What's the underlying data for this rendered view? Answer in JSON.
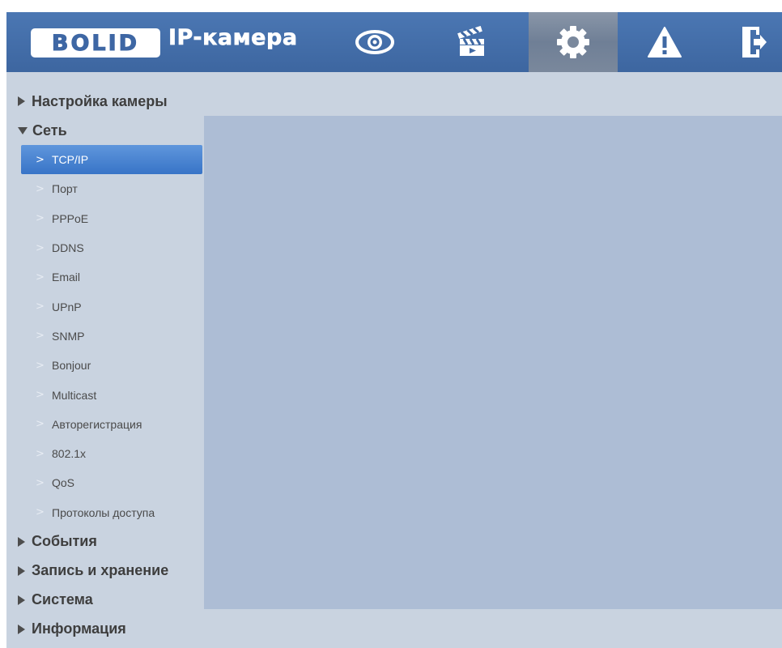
{
  "brand": {
    "logo": "BOLID",
    "title": "IP-камера"
  },
  "nav": [
    {
      "name": "live-view",
      "icon": "eye-icon"
    },
    {
      "name": "playback",
      "icon": "clapperboard-icon"
    },
    {
      "name": "setup",
      "icon": "gear-icon",
      "active": true
    },
    {
      "name": "alarm",
      "icon": "warning-icon"
    },
    {
      "name": "logout",
      "icon": "exit-icon"
    }
  ],
  "colors": {
    "header": "#3f68a3",
    "sidebar_bg": "#c9d3e0",
    "content_bg": "#adbdd5",
    "active_item": "#3874c7"
  },
  "sidebar": {
    "sections": [
      {
        "label": "Настройка камеры",
        "expanded": false
      },
      {
        "label": "Сеть",
        "expanded": true
      },
      {
        "label": "События",
        "expanded": false
      },
      {
        "label": "Запись и хранение",
        "expanded": false
      },
      {
        "label": "Система",
        "expanded": false
      },
      {
        "label": "Информация",
        "expanded": false
      }
    ],
    "network_items": [
      {
        "label": "TCP/IP",
        "active": true
      },
      {
        "label": "Порт"
      },
      {
        "label": "PPPoE"
      },
      {
        "label": "DDNS"
      },
      {
        "label": "Email"
      },
      {
        "label": "UPnP"
      },
      {
        "label": "SNMP"
      },
      {
        "label": "Bonjour"
      },
      {
        "label": "Multicast"
      },
      {
        "label": "Авторегистрация"
      },
      {
        "label": "802.1x"
      },
      {
        "label": "QoS"
      },
      {
        "label": "Протоколы доступа"
      }
    ]
  }
}
